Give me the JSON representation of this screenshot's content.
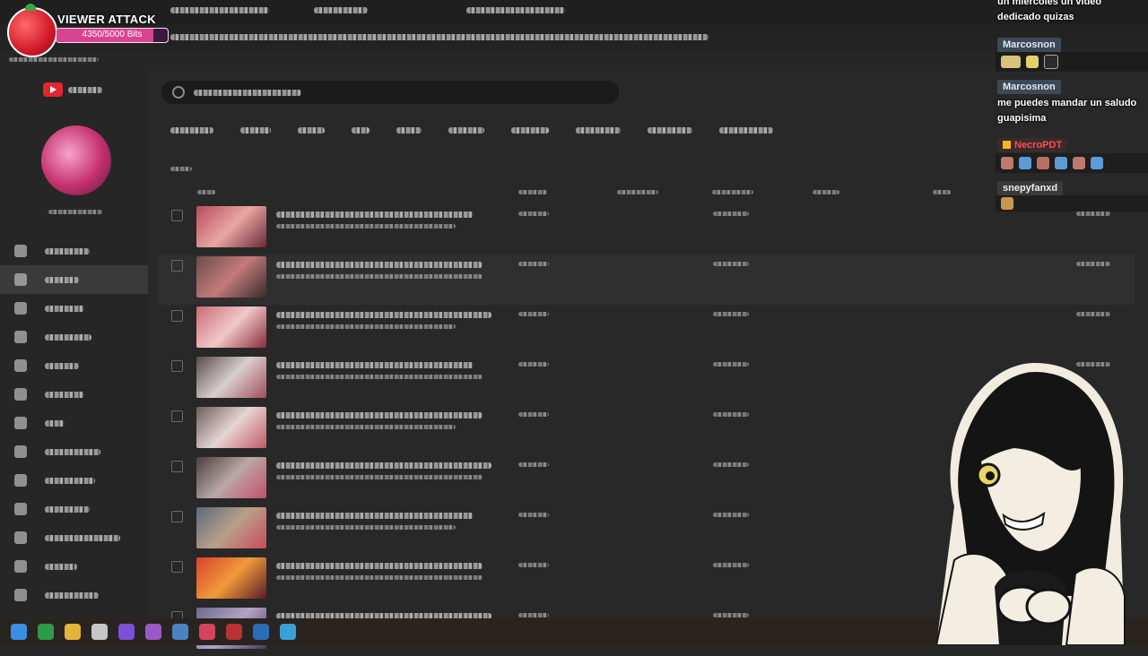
{
  "overlay": {
    "alert_title": "VIEWER ATTACK",
    "progress_text": "4350/5000 Bits",
    "progress_fraction": 0.87
  },
  "chat": {
    "messages": [
      {
        "user": "",
        "text": "un miercoles un video dedicado quizas"
      },
      {
        "user": "Marcosnon",
        "text": "",
        "emotes": [
          "emote-cat",
          "emote-face"
        ]
      },
      {
        "user": "Marcosnon",
        "text": "me puedes mandar un saludo guapisima"
      },
      {
        "user": "NecroPDT",
        "text": "",
        "emotes": [
          "emote-1",
          "emote-2",
          "emote-3",
          "emote-4",
          "emote-5",
          "emote-6"
        ]
      },
      {
        "user": "snepyfanxd",
        "text": "",
        "emotes": [
          "emote-1"
        ]
      }
    ]
  },
  "colors": {
    "bg": "#282828",
    "accent": "#e3262f",
    "alert_pink": "#d7448f",
    "name_red": "#ff4b5a"
  },
  "table": {
    "rows": 9,
    "active_row": 1
  }
}
